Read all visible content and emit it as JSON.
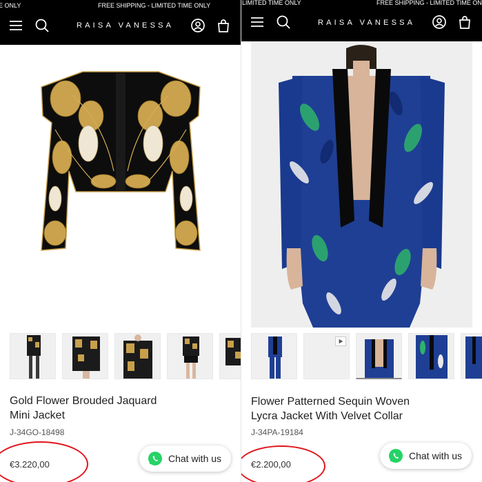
{
  "store": {
    "logo_text": "RAISA VANESSA"
  },
  "promo": {
    "left_fragment": "E ONLY",
    "center": "FREE SHIPPING - LIMITED TIME ONLY",
    "right_left_fragment": "LIMITED TIME ONLY",
    "right_right": "FREE SHIPPING - LIMITED TIME ONL"
  },
  "nav": {
    "menu_icon": "menu-icon",
    "search_icon": "search-icon",
    "account_icon": "account-icon",
    "cart_icon": "shopping-bag-icon"
  },
  "left_product": {
    "title": "Gold Flower Brouded Jaquard\nMini Jacket",
    "sku": "J-34GO-18498",
    "price": "€3.220,00",
    "thumbnail_count": 5
  },
  "right_product": {
    "title": "Flower Patterned Sequin Woven\nLycra Jacket With Velvet Collar",
    "sku": "J-34PA-19184",
    "price": "€2.200,00",
    "thumbnail_count": 5,
    "video_thumbnail_index": 1,
    "active_thumbnail_index": 2
  },
  "chat": {
    "label": "Chat with us",
    "icon": "whatsapp-icon"
  },
  "colors": {
    "topbar": "#000000",
    "highlight_circle": "#e0161b",
    "chat_icon": "#25D366"
  }
}
